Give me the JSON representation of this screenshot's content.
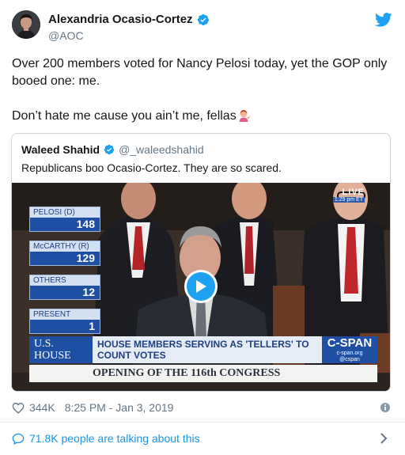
{
  "author": {
    "name": "Alexandria Ocasio-Cortez",
    "handle": "@AOC"
  },
  "tweet": {
    "line1": "Over 200 members voted for Nancy Pelosi today, yet the GOP only booed one: me.",
    "line2": "Don’t hate me cause you ain’t me, fellas"
  },
  "quoted": {
    "name": "Waleed Shahid",
    "handle": "@_waleedshahid",
    "text": "Republicans boo Ocasio-Cortez. They are so scared."
  },
  "video": {
    "live_label": "LIVE",
    "live_time": "1:29 pm ET",
    "votes": [
      {
        "label": "PELOSI (D)",
        "value": "148"
      },
      {
        "label": "McCARTHY (R)",
        "value": "129"
      },
      {
        "label": "OTHERS",
        "value": "12"
      },
      {
        "label": "PRESENT",
        "value": "1"
      }
    ],
    "banner_left": "U.S. HOUSE",
    "banner_middle": "HOUSE MEMBERS SERVING AS 'TELLERS' TO COUNT VOTES",
    "network": "C-SPAN",
    "network_url": "c-span.org",
    "network_handle": "@cspan",
    "headline": "OPENING OF THE 116th CONGRESS"
  },
  "footer": {
    "likes": "344K",
    "timestamp": "8:25 PM - Jan 3, 2019",
    "talking": "71.8K people are talking about this"
  },
  "colors": {
    "accent": "#1da1f2",
    "link": "#1b95e0",
    "text": "#14171a",
    "muted": "#657786",
    "cspan_blue": "#1f4fa3"
  },
  "icons": [
    "verified-badge-icon",
    "twitter-bird-icon",
    "woman-tipping-hand-emoji",
    "play-icon",
    "heart-icon",
    "info-icon",
    "speech-bubble-icon",
    "chevron-right-icon"
  ]
}
